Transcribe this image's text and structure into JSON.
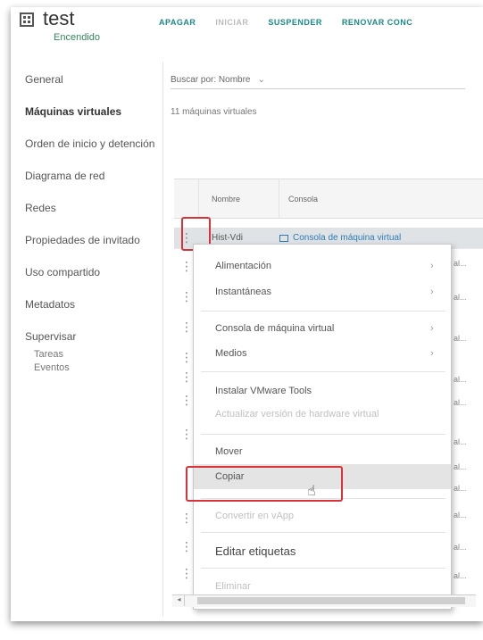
{
  "header": {
    "title": "test",
    "status": "Encendido"
  },
  "toolbar": [
    {
      "label": "APAGAR",
      "enabled": true
    },
    {
      "label": "INICIAR",
      "enabled": false
    },
    {
      "label": "SUSPENDER",
      "enabled": true
    },
    {
      "label": "RENOVAR CONC",
      "enabled": true
    }
  ],
  "nav": {
    "items": [
      {
        "label": "General"
      },
      {
        "label": "Máquinas virtuales",
        "selected": true
      },
      {
        "label": "Orden de inicio y detención"
      },
      {
        "label": "Diagrama de red"
      },
      {
        "label": "Redes"
      },
      {
        "label": "Propiedades de invitado"
      },
      {
        "label": "Uso compartido"
      },
      {
        "label": "Metadatos"
      },
      {
        "label": "Supervisar"
      }
    ],
    "sub_items": [
      "Tareas",
      "Eventos"
    ]
  },
  "content": {
    "search_label": "Buscar por: Nombre",
    "count_text": "11 máquinas virtuales",
    "table": {
      "columns": [
        "Nombre",
        "Consola"
      ],
      "selected_row": {
        "name": "Hist-Vdi",
        "console": "Consola de máquina virtual"
      },
      "truncated_cells": [
        "al...",
        "al...",
        "al...",
        "al...",
        "al...",
        "al...",
        "al...",
        "al...",
        "al...",
        "al...",
        "al..."
      ]
    }
  },
  "context_menu": {
    "items": [
      {
        "label": "Alimentación",
        "submenu": true
      },
      {
        "label": "Instantáneas",
        "submenu": true
      },
      {
        "label": "Consola de máquina virtual",
        "submenu": true
      },
      {
        "label": "Medios",
        "submenu": true
      },
      {
        "label": "Instalar VMware Tools"
      },
      {
        "label": "Actualizar versión de hardware virtual",
        "disabled": true
      },
      {
        "label": "Mover"
      },
      {
        "label": "Copiar"
      },
      {
        "label": "Convertir en vApp",
        "disabled": true
      },
      {
        "label": "Editar etiquetas"
      },
      {
        "label": "Eliminar",
        "disabled": true
      }
    ],
    "arrow_glyph": "›"
  },
  "colors": {
    "accent": "#1a8a8a",
    "highlight": "#d8333b",
    "status_green": "#2e8b57",
    "link_blue": "#2c7bb6"
  }
}
